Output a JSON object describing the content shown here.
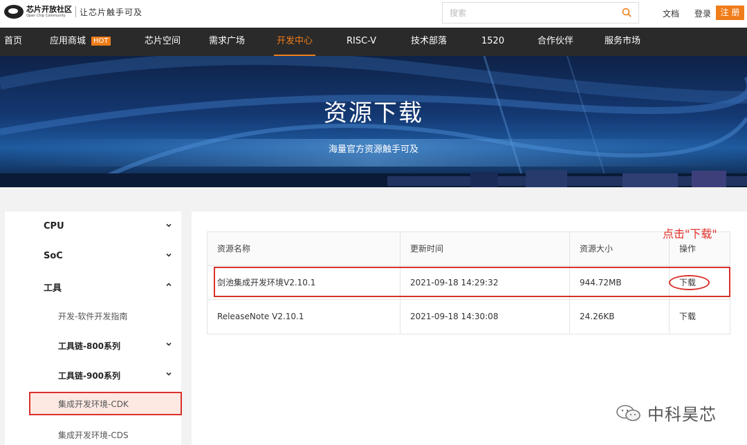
{
  "topbar": {
    "logo_name": "芯片开放社区",
    "logo_sub": "Open Chip Community",
    "slogan": "让芯片触手可及",
    "search_placeholder": "搜索",
    "docs_label": "文档",
    "login_label": "登录",
    "register_label": "注 册"
  },
  "nav": {
    "items": [
      {
        "label": "首页"
      },
      {
        "label": "应用商城",
        "badge": "HOT"
      },
      {
        "label": "芯片空间"
      },
      {
        "label": "需求广场"
      },
      {
        "label": "开发中心"
      },
      {
        "label": "RISC-V"
      },
      {
        "label": "技术部落"
      },
      {
        "label": "1520"
      },
      {
        "label": "合作伙伴"
      },
      {
        "label": "服务市场"
      }
    ]
  },
  "banner": {
    "title": "资源下载",
    "subtitle": "海量官方资源触手可及"
  },
  "sidebar": {
    "items": [
      {
        "label": "CPU"
      },
      {
        "label": "SoC"
      },
      {
        "label": "工具"
      },
      {
        "label": "开发-软件开发指南"
      },
      {
        "label": "工具链-800系列"
      },
      {
        "label": "工具链-900系列"
      },
      {
        "label": "集成开发环境-CDK"
      },
      {
        "label": "集成开发环境-CDS"
      }
    ]
  },
  "table": {
    "headers": [
      "资源名称",
      "更新时间",
      "资源大小",
      "操作"
    ],
    "rows": [
      {
        "name": "剑池集成开发环境V2.10.1",
        "time": "2021-09-18 14:29:32",
        "size": "944.72MB",
        "action": "下载"
      },
      {
        "name": "ReleaseNote V2.10.1",
        "time": "2021-09-18 14:30:08",
        "size": "24.26KB",
        "action": "下载"
      }
    ]
  },
  "annotation": "点击\"下载\"",
  "watermark": "中科昊芯",
  "colors": {
    "accent": "#f07d1a",
    "highlight": "#d9302a",
    "nav_bg": "#2a2a2a"
  }
}
